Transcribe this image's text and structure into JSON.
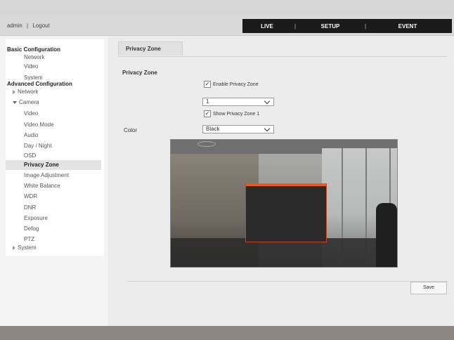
{
  "header": {
    "user": "admin",
    "separator": "|",
    "logout": "Logout",
    "nav": {
      "live": "LIVE",
      "setup": "SETUP",
      "event": "EVENT",
      "sep": "|"
    }
  },
  "sidebar": {
    "basic_title": "Basic Configuration",
    "basic_items": [
      "Network",
      "Video",
      "System"
    ],
    "advanced_title": "Advanced Configuration",
    "network": "Network",
    "camera": "Camera",
    "camera_items": [
      "Video",
      "Video Mode",
      "Audio",
      "Day / Night",
      "OSD",
      "Privacy Zone",
      "Image Adjustment",
      "White Balance",
      "WDR",
      "DNR",
      "Exposure",
      "Defog",
      "PTZ"
    ],
    "system": "System",
    "active_item": "Privacy Zone"
  },
  "main": {
    "tab_label": "Privacy Zone",
    "section_title": "Privacy Zone",
    "enable_label": "Enable Privacy Zone",
    "enable_checked": true,
    "zone_select": "1",
    "show_label": "Show Privacy Zone 1",
    "show_checked": true,
    "color_label": "Color",
    "color_value": "Black",
    "save_label": "Save"
  },
  "colors": {
    "nav_bg": "#1a1a1a",
    "zone_border": "#e85a1e",
    "footer": "#8d8681"
  }
}
